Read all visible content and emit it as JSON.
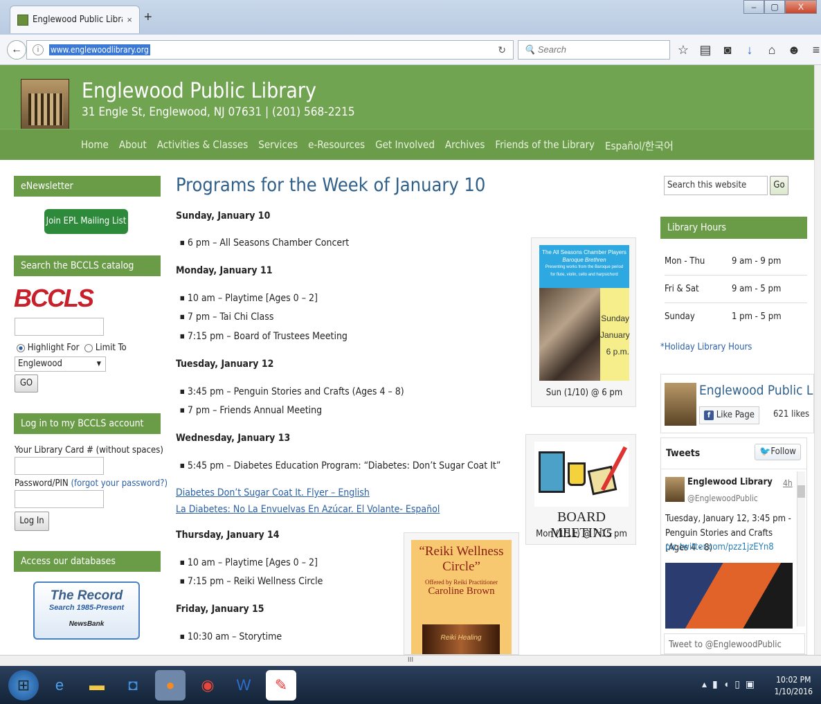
{
  "browser": {
    "tab_title": "Englewood Public Library. ...",
    "tab_close": "×",
    "new_tab": "+",
    "url": "www.englewoodlibrary.org",
    "search_placeholder": "Search",
    "window_controls": {
      "minimize": "–",
      "maximize": "▢",
      "close": "X"
    }
  },
  "site": {
    "title": "Englewood Public Library",
    "address": "31 Engle St, Englewood, NJ 07631 | (201) 568-2215",
    "nav": [
      "Home",
      "About",
      "Activities & Classes",
      "Services",
      "e-Resources",
      "Get Involved",
      "Archives",
      "Friends of the Library",
      "Español/한국어"
    ],
    "brand_color": "#70a450"
  },
  "left": {
    "enewsletter_title": "eNewsletter",
    "mailing_button": "Join EPL Mailing List",
    "bccls_title": "Search the BCCLS catalog",
    "bccls_logo": "BCCLS",
    "highlight_label": "Highlight For",
    "limit_label": "Limit To",
    "select_value": "Englewood",
    "go_label": "GO",
    "login_title": "Log in to my BCCLS account",
    "card_label": "Your Library Card # (without spaces)",
    "pin_label": "Password/PIN",
    "forgot_link": "(forgot your password?)",
    "login_button": "Log In",
    "databases_title": "Access our databases",
    "record_title": "The Record",
    "record_sub": "Search 1985-Present",
    "newsbank": "NewsBank"
  },
  "center": {
    "heading": "Programs for the Week of January 10",
    "days": [
      {
        "day": "Sunday, January 10",
        "events": [
          "6 pm – All Seasons Chamber Concert"
        ]
      },
      {
        "day": "Monday, January 11",
        "events": [
          "10 am – Playtime [Ages 0 – 2]",
          "7 pm – Tai Chi Class",
          "7:15 pm – Board of Trustees Meeting"
        ]
      },
      {
        "day": "Tuesday, January 12",
        "events": [
          "3:45 pm – Penguin Stories and Crafts (Ages 4 – 8)",
          "7 pm – Friends Annual Meeting"
        ]
      },
      {
        "day": "Wednesday, January 13",
        "events": [
          "5:45 pm – Diabetes Education Program: “Diabetes: Don’t Sugar Coat It”"
        ]
      },
      {
        "day": "Thursday,  January 14",
        "events": [
          "10 am – Playtime [Ages 0 – 2]",
          "7:15 pm – Reiki Wellness Circle"
        ]
      },
      {
        "day": "Friday, January 15",
        "events": [
          "10:30 am – Storytime"
        ]
      }
    ],
    "links": [
      "Diabetes Don’t Sugar Coat It. Flyer – English",
      "La Diabetes: No La Envuelvas En Azúcar. El Volante- Español"
    ],
    "concert_card": {
      "line1": "The All Seasons Chamber Players",
      "line2": "Baroque Brethren",
      "line3": "Presenting works from the Baroque period",
      "line4": "for flute, violin, cello and harpsichord",
      "side1": "Sunday",
      "side2": "January",
      "side3": "6 p.m.",
      "caption": "Sun (1/10) @ 6 pm"
    },
    "board_card": {
      "label": "BOARD MEETING",
      "caption": "Mon (1/11) @ 7:15 pm"
    },
    "reiki_card": {
      "title": "“Reiki Wellness Circle”",
      "sub": "Offered by Reiki Practitioner",
      "name": "Caroline Brown",
      "image_text": "Reiki Healing"
    }
  },
  "right": {
    "search_placeholder": "Search this website",
    "go_label": "Go",
    "hours_title": "Library Hours",
    "hours": [
      {
        "days": "Mon - Thu",
        "time": "9 am - 9 pm"
      },
      {
        "days": "Fri & Sat",
        "time": "9 am - 5 pm"
      },
      {
        "days": "Sunday",
        "time": "1 pm - 5 pm"
      }
    ],
    "holiday_link": "*Holiday Library Hours",
    "fb_name": "Englewood Public Library",
    "fb_like": "Like Page",
    "fb_likes": "621 likes",
    "tweets_title": "Tweets",
    "follow": "Follow",
    "tweet_name": "Englewood Library",
    "tweet_time": "4h",
    "tweet_handle": "@EnglewoodPublic",
    "tweet_text": "Tuesday, January 12, 3:45 pm - Penguin Stories and Crafts (Ages 4 - 8)",
    "tweet_link": "pic.twitter.com/pzz1jzEYn8",
    "tweet_to": "Tweet to @EnglewoodPublic"
  },
  "taskbar": {
    "time": "10:02 PM",
    "date": "1/10/2016"
  },
  "scroll_mark": "III"
}
